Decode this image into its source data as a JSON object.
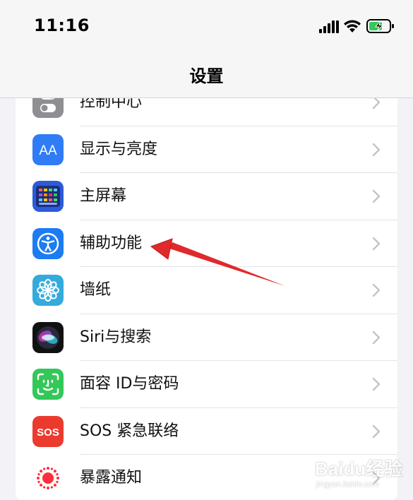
{
  "status_bar": {
    "time": "11:16",
    "signal_icon": "cellular-signal-icon",
    "wifi_icon": "wifi-icon",
    "battery_icon": "battery-charging-icon",
    "battery_level": 0.55,
    "battery_color": "#34c759"
  },
  "nav": {
    "title": "设置"
  },
  "settings": {
    "items": [
      {
        "label": "控制中心",
        "icon": "control-center-icon",
        "color": "#8e8e93"
      },
      {
        "label": "显示与亮度",
        "icon_text": "AA",
        "icon": "display-brightness-icon",
        "color": "#2f7cf6"
      },
      {
        "label": "主屏幕",
        "icon": "home-screen-icon",
        "color": "#2c5bd8"
      },
      {
        "label": "辅助功能",
        "icon": "accessibility-icon",
        "color": "#1c7cf2"
      },
      {
        "label": "墙纸",
        "icon": "wallpaper-icon",
        "color": "#35aadc"
      },
      {
        "label": "Siri与搜索",
        "icon": "siri-icon",
        "color": "#111111"
      },
      {
        "label": "面容 ID与密码",
        "icon": "face-id-icon",
        "color": "#34c759"
      },
      {
        "label": "SOS 紧急联络",
        "icon_text": "SOS",
        "icon": "sos-icon",
        "color": "#eb3b2f"
      },
      {
        "label": "暴露通知",
        "icon": "exposure-notification-icon",
        "color": "#ffffff"
      }
    ]
  },
  "annotation": {
    "icon": "red-arrow-pointer",
    "color": "#e0292b"
  },
  "watermark": {
    "main": "Baidu经验",
    "sub": "jingyan.baidu.com"
  }
}
